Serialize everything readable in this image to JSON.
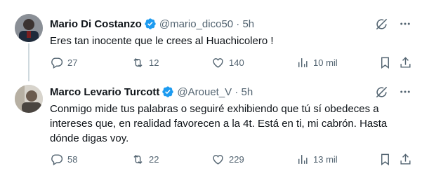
{
  "tweets": [
    {
      "name": "Mario Di Costanzo",
      "handle": "@mario_dico50",
      "time": "5h",
      "text": "Eres tan inocente que le crees al Huachicolero !",
      "replies": "27",
      "retweets": "12",
      "likes": "140",
      "views": "10 mil"
    },
    {
      "name": "Marco Levario Turcott",
      "handle": "@Arouet_V",
      "time": "5h",
      "text": "Conmigo mide tus palabras o seguiré exhibiendo que tú sí obedeces a intereses que, en realidad favorecen a la 4t. Está en ti, mi cabrón. Hasta dónde digas voy.",
      "replies": "58",
      "retweets": "22",
      "likes": "229",
      "views": "13 mil"
    }
  ],
  "colors": {
    "verified": "#1d9bf0",
    "secondary": "#536471",
    "thread_line": "#cfd9de"
  },
  "icons": [
    "grok-icon",
    "more-icon",
    "reply-icon",
    "retweet-icon",
    "like-icon",
    "views-icon",
    "bookmark-icon",
    "share-icon"
  ]
}
